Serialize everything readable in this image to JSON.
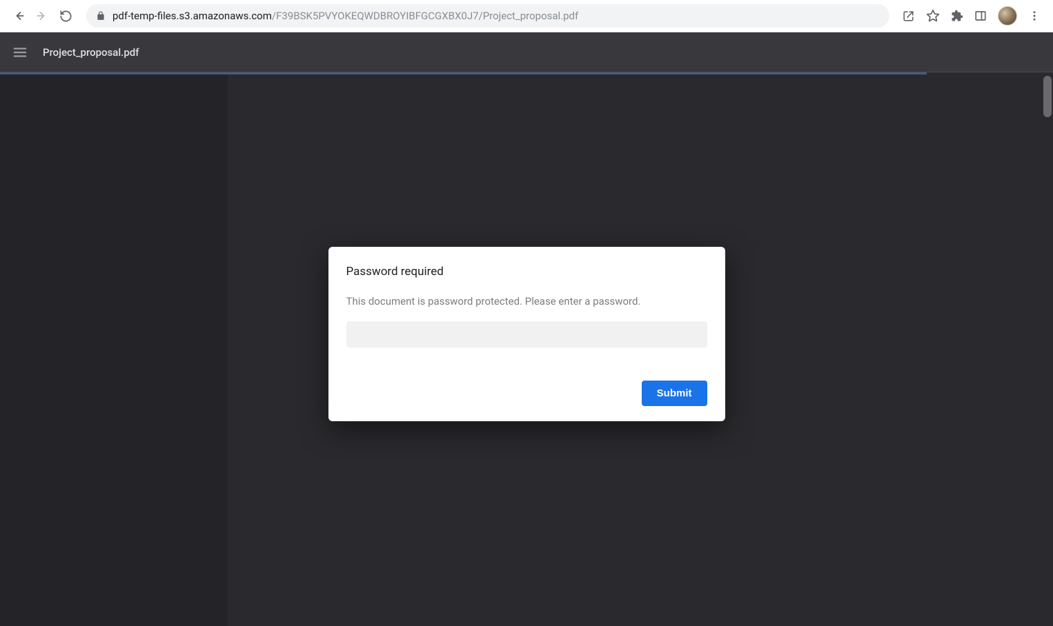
{
  "browser": {
    "url_domain": "pdf-temp-files.s3.amazonaws.com",
    "url_path": "/F39BSK5PVYOKEQWDBROYIBFGCGXBX0J7/Project_proposal.pdf"
  },
  "pdf_viewer": {
    "filename": "Project_proposal.pdf"
  },
  "dialog": {
    "title": "Password required",
    "message": "This document is password protected. Please enter a password.",
    "password_value": "",
    "submit_label": "Submit"
  }
}
